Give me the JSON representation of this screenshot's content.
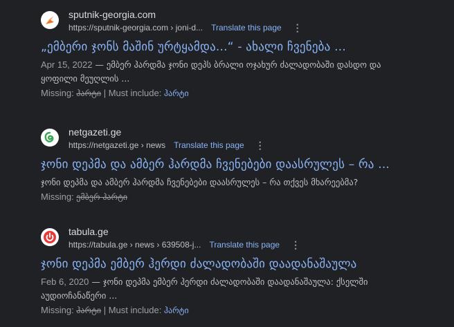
{
  "results": [
    {
      "site_name": "sputnik-georgia.com",
      "url": "https://sputnik-georgia.com › joni-d...",
      "translate": "Translate this page",
      "more": "⋮",
      "title": "„ემბერი ჯონს მაშინ ურტყამდა...“ - ახალი ჩვენება ...",
      "date": "Apr 15, 2022",
      "snippet": " — ემბერ ჰარდმა ჯონი დეპს ბრალი ოჯახურ ძალადობაში დასდო და ყოფილი მეუღლის ...",
      "missing_label": "Missing: ",
      "missing_word": "ჰარტი",
      "separator": " | ",
      "must_include_label": "Must include: ",
      "must_include_word": "ჰარტი",
      "favicon": "sputnik-icon",
      "favicon_color": "#f37021"
    },
    {
      "site_name": "netgazeti.ge",
      "url": "https://netgazeti.ge › news",
      "translate": "Translate this page",
      "more": "⋮",
      "title": "ჯონი დეპმა და ამბერ ჰარდმა ჩვენებები დაასრულეს – რა ...",
      "snippet": "ჯონი დეპმა და ამბერ ჰარდმა ჩვენებები დაასრულეს – რა თქვეს მხარეებმა?",
      "missing_label": "Missing: ",
      "missing_words": "ემბერ ჰარტი",
      "favicon": "netgazeti-icon",
      "favicon_color": "#3aa655"
    },
    {
      "site_name": "tabula.ge",
      "url": "https://tabula.ge › news › 639508-j...",
      "translate": "Translate this page",
      "more": "⋮",
      "title": "ჯონი დეპმა ემბერ ჰერდი ძალადობაში დაადანაშაულა",
      "date": "Feb 6, 2020",
      "snippet": " — ჯონი დეპმა ემბერ ჰერდი ძალადობაში დაადანაშაულა: ქსელში აუდიოჩანაწერი ...",
      "missing_label": "Missing: ",
      "missing_word": "ჰარტი",
      "separator": " | ",
      "must_include_label": "Must include: ",
      "must_include_word": "ჰარტი",
      "favicon": "tabula-power-icon",
      "favicon_color": "#e53935"
    }
  ]
}
